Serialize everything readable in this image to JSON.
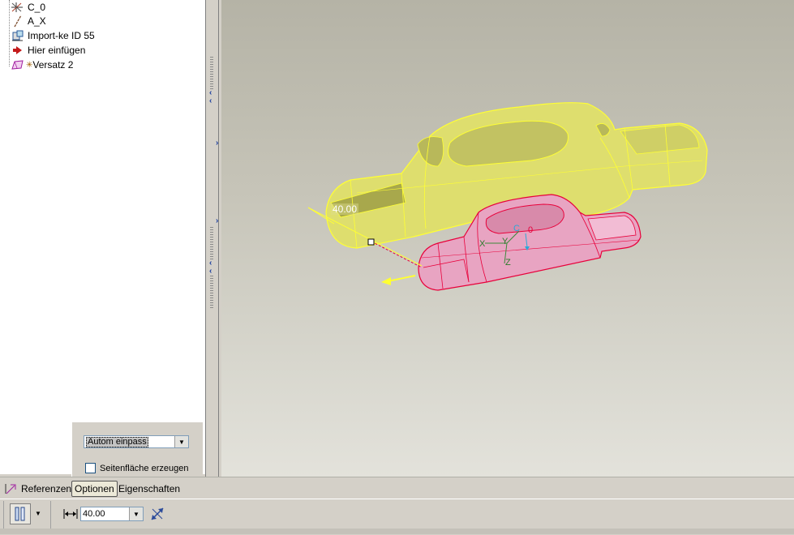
{
  "model_tree": {
    "items": [
      {
        "label": "C_0",
        "icon": "coordinate-system-icon"
      },
      {
        "label": "A_X",
        "icon": "axis-icon"
      },
      {
        "label": "Import-ke ID 55",
        "icon": "import-feature-icon"
      },
      {
        "label": "Hier einfügen",
        "icon": "insert-here-arrow-icon"
      },
      {
        "label": "Versatz 2",
        "icon": "offset-feature-icon"
      }
    ]
  },
  "viewport": {
    "dimension_label": "40.00",
    "csys_labels": {
      "x": "X",
      "y": "Y",
      "z": "Z",
      "c": "C",
      "o": "0"
    },
    "colors": {
      "model_fill": "#dede6e",
      "model_edge": "#ffff33",
      "preview_fill": "#e4a0bc",
      "preview_edge": "#e8003a",
      "arrow": "#ffff33"
    }
  },
  "options_panel": {
    "method_select": "Autom einpass",
    "create_side_surface_label": "Seitenfläche erzeugen"
  },
  "tabs": [
    {
      "label": "Referenzen",
      "icon": "references-icon"
    },
    {
      "label": "Optionen",
      "active": true
    },
    {
      "label": "Eigenschaften"
    }
  ],
  "dashboard": {
    "offset_value": "40.00",
    "flip_icon": "flip-direction-icon",
    "type_icon": "offset-type-icon",
    "distance_icon": "distance-icon"
  }
}
